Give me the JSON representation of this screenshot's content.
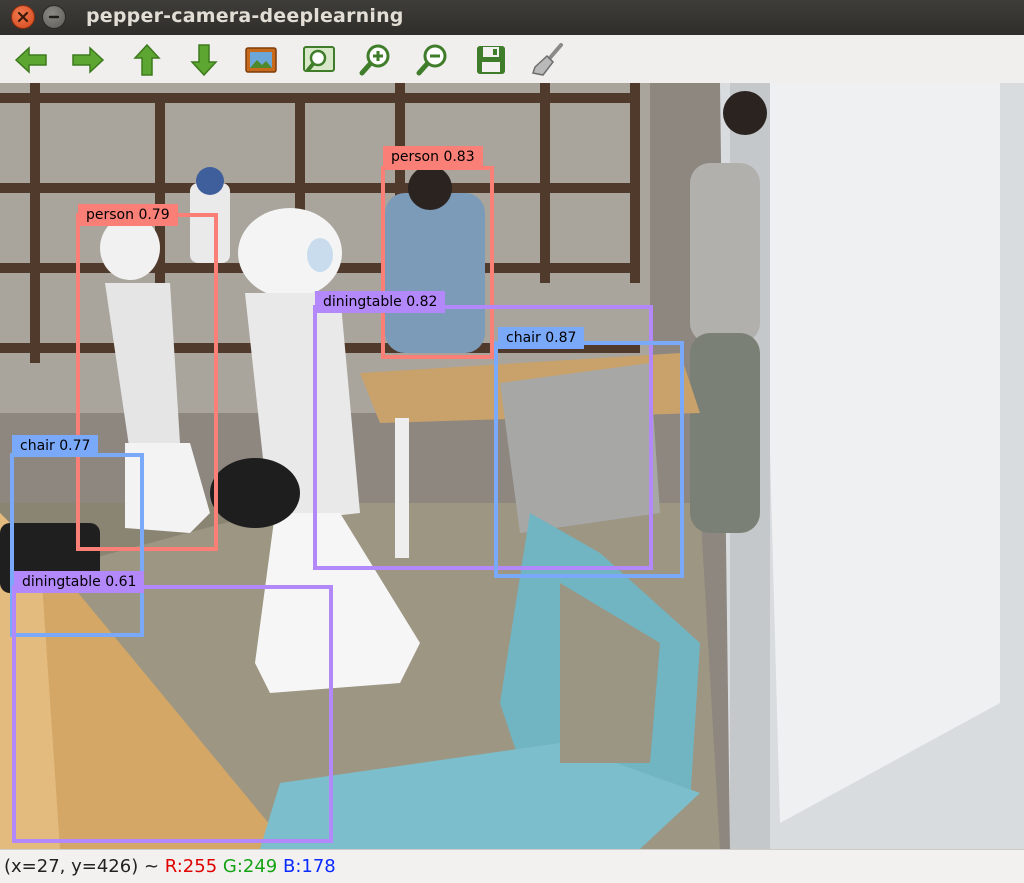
{
  "window": {
    "title": "pepper-camera-deeplearning"
  },
  "toolbar": {
    "buttons": [
      {
        "name": "back-icon",
        "color": "#5ea632"
      },
      {
        "name": "forward-icon",
        "color": "#5ea632"
      },
      {
        "name": "up-icon",
        "color": "#5ea632"
      },
      {
        "name": "down-icon",
        "color": "#5ea632"
      },
      {
        "name": "image-icon",
        "color": "#c86a1c"
      },
      {
        "name": "zoom-fit-icon",
        "color": "#3f7d2a"
      },
      {
        "name": "zoom-in-icon",
        "color": "#3f7d2a"
      },
      {
        "name": "zoom-out-icon",
        "color": "#3f7d2a"
      },
      {
        "name": "save-icon",
        "color": "#3f7d2a"
      },
      {
        "name": "clear-icon",
        "color": "#8a8a8a"
      }
    ]
  },
  "detections": [
    {
      "label": "person 0.79",
      "color": "#fa7f77"
    },
    {
      "label": "person 0.83",
      "color": "#fa7f77"
    },
    {
      "label": "diningtable 0.82",
      "color": "#b388fa"
    },
    {
      "label": "chair 0.87",
      "color": "#7ba9fa"
    },
    {
      "label": "chair 0.77",
      "color": "#7ba9fa"
    },
    {
      "label": "diningtable 0.61",
      "color": "#b388fa"
    }
  ],
  "status": {
    "position": "(x=27, y=426) ~",
    "r": "R:255",
    "g": "G:249",
    "b": "B:178"
  }
}
